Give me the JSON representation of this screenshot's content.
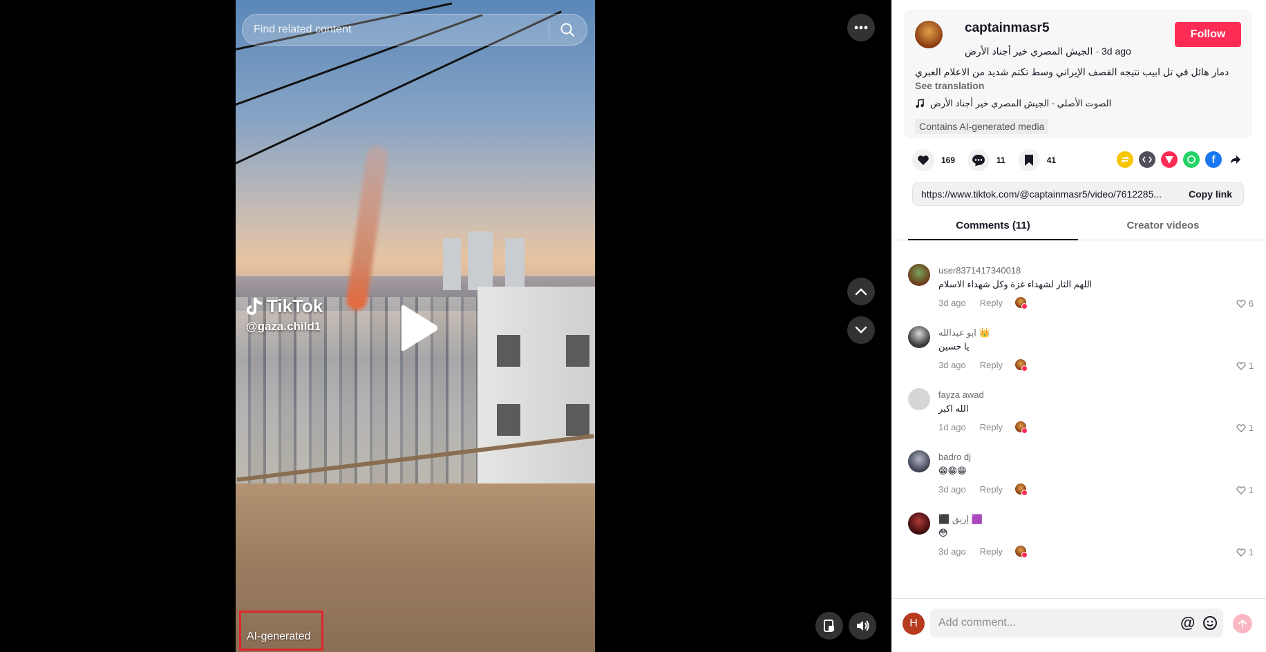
{
  "search": {
    "placeholder": "Find related content"
  },
  "video": {
    "watermark_brand": "TikTok",
    "watermark_user": "@gaza.child1",
    "ai_label": "AI-generated"
  },
  "author": {
    "username": "captainmasr5",
    "nickname": "الجيش المصري خير أجناد الأرض",
    "time": "3d ago",
    "follow_label": "Follow"
  },
  "post": {
    "description": "دمار هائل في تل ابيب نتيجه القصف الإيراني وسط تكتم شديد من الاعلام العبري",
    "see_translation": "See translation",
    "music": "الصوت الأصلي - الجيش المصري خير أجناد الأرض",
    "ai_tag": "Contains AI-generated media"
  },
  "stats": {
    "likes": "169",
    "comments": "11",
    "saves": "41"
  },
  "share_link": {
    "url": "https://www.tiktok.com/@captainmasr5/video/7612285...",
    "copy_label": "Copy link"
  },
  "tabs": {
    "comments": "Comments (11)",
    "creator_videos": "Creator videos"
  },
  "comments": [
    {
      "user": "user8371417340018",
      "text": "اللهم الثار لشهداء غزة وكل شهداء الاسلام",
      "time": "3d ago",
      "likes": "6"
    },
    {
      "user": "ابو عبدالله 👑",
      "text": "يا حسين",
      "time": "3d ago",
      "likes": "1"
    },
    {
      "user": "fayza awad",
      "text": "الله اكبر",
      "time": "1d ago",
      "likes": "1"
    },
    {
      "user": "badro dj",
      "text": "😁😁😁",
      "time": "3d ago",
      "likes": "1"
    },
    {
      "user": "⬛ إريق 🟪",
      "text": "😳",
      "time": "3d ago",
      "likes": "1"
    }
  ],
  "reply_label": "Reply",
  "composer": {
    "placeholder": "Add comment...",
    "avatar_letter": "H"
  },
  "colors": {
    "accent": "#fe2c55",
    "ai_box": "#e0262b"
  }
}
